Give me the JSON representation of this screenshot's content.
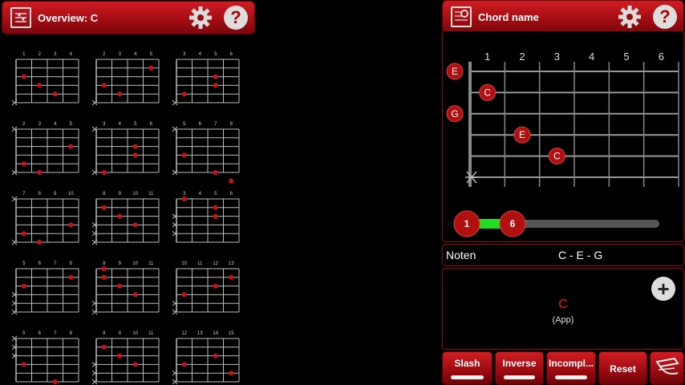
{
  "left_header": {
    "title": "Overview: C"
  },
  "right_header": {
    "title": "Chord name"
  },
  "overview": {
    "diagrams": [
      {
        "frets": [
          1,
          2,
          3,
          4
        ],
        "dots": [
          [
            2,
            1
          ],
          [
            3,
            2
          ],
          [
            4,
            3
          ]
        ],
        "mutes": [
          6
        ]
      },
      {
        "frets": [
          2,
          3,
          4,
          5
        ],
        "dots": [
          [
            1,
            4
          ],
          [
            3,
            1
          ],
          [
            4,
            2
          ]
        ],
        "mutes": [
          6
        ]
      },
      {
        "frets": [
          3,
          4,
          5,
          6
        ],
        "dots": [
          [
            2,
            3
          ],
          [
            3,
            3
          ],
          [
            4,
            1
          ]
        ],
        "mutes": [
          6
        ]
      },
      {
        "frets": [
          2,
          3,
          4,
          5
        ],
        "dots": [
          [
            2,
            4
          ],
          [
            4,
            1
          ],
          [
            5,
            2
          ]
        ],
        "mutes": [
          6,
          1
        ]
      },
      {
        "frets": [
          3,
          4,
          5,
          6
        ],
        "dots": [
          [
            2,
            3
          ],
          [
            3,
            3
          ],
          [
            5,
            1
          ]
        ],
        "mutes": [
          6,
          1
        ]
      },
      {
        "frets": [
          5,
          6,
          7,
          8
        ],
        "dots": [
          [
            3,
            1
          ],
          [
            5,
            3
          ],
          [
            6,
            4
          ]
        ],
        "mutes": [
          6,
          1
        ]
      },
      {
        "frets": [
          7,
          8,
          9,
          10
        ],
        "dots": [
          [
            3,
            4
          ],
          [
            4,
            1
          ],
          [
            5,
            2
          ]
        ],
        "mutes": [
          6,
          1
        ]
      },
      {
        "frets": [
          8,
          9,
          10,
          11
        ],
        "dots": [
          [
            1,
            1
          ],
          [
            2,
            2
          ],
          [
            3,
            3
          ]
        ],
        "mutes": [
          6,
          5,
          4
        ]
      },
      {
        "frets": [
          3,
          4,
          5,
          6
        ],
        "dots": [
          [
            0,
            1
          ],
          [
            1,
            3
          ],
          [
            2,
            3
          ]
        ],
        "mutes": [
          5,
          4,
          3
        ]
      },
      {
        "frets": [
          5,
          6,
          7,
          8
        ],
        "dots": [
          [
            1,
            4
          ],
          [
            2,
            1
          ]
        ],
        "mutes": [
          6,
          5,
          4
        ]
      },
      {
        "frets": [
          8,
          9,
          10,
          11
        ],
        "dots": [
          [
            0,
            1
          ],
          [
            1,
            1
          ],
          [
            2,
            2
          ],
          [
            3,
            3
          ]
        ],
        "mutes": [
          6,
          5
        ]
      },
      {
        "frets": [
          10,
          11,
          12,
          13
        ],
        "dots": [
          [
            1,
            4
          ],
          [
            2,
            3
          ],
          [
            3,
            1
          ]
        ],
        "mutes": [
          6,
          5
        ]
      },
      {
        "frets": [
          5,
          6,
          7,
          8
        ],
        "dots": [
          [
            3,
            1
          ],
          [
            5,
            3
          ],
          [
            6,
            4
          ]
        ],
        "mutes": [
          1,
          2,
          3
        ]
      },
      {
        "frets": [
          8,
          9,
          10,
          11
        ],
        "dots": [
          [
            1,
            1
          ],
          [
            2,
            2
          ],
          [
            3,
            3
          ]
        ],
        "mutes": [
          6,
          5,
          4
        ]
      },
      {
        "frets": [
          12,
          13,
          14,
          15
        ],
        "dots": [
          [
            2,
            3
          ],
          [
            3,
            1
          ],
          [
            4,
            4
          ]
        ],
        "mutes": [
          5,
          6
        ]
      }
    ]
  },
  "fretboard": {
    "fret_numbers": [
      "1",
      "2",
      "3",
      "4",
      "5",
      "6"
    ],
    "open_notes": [
      {
        "label": "E",
        "string": 0
      },
      {
        "label": "G",
        "string": 2
      }
    ],
    "fretted_notes": [
      {
        "label": "C",
        "string": 1,
        "fret": 1
      },
      {
        "label": "E",
        "string": 3,
        "fret": 2
      },
      {
        "label": "C",
        "string": 4,
        "fret": 3
      }
    ],
    "muted_string": 5,
    "range": {
      "from": "1",
      "to": "6",
      "min_fraction": 0.0,
      "max_fraction": 0.2
    }
  },
  "notes": {
    "label": "Noten",
    "value": "C - E - G"
  },
  "result": {
    "chord": "C",
    "subtitle": "(App)"
  },
  "buttons": {
    "slash": "Slash",
    "inverse": "Inverse",
    "incomplete": "Incompl...",
    "reset": "Reset"
  },
  "colors": {
    "accent": "#c0141c",
    "dot": "#d01010",
    "range_fill": "#22dd22"
  }
}
